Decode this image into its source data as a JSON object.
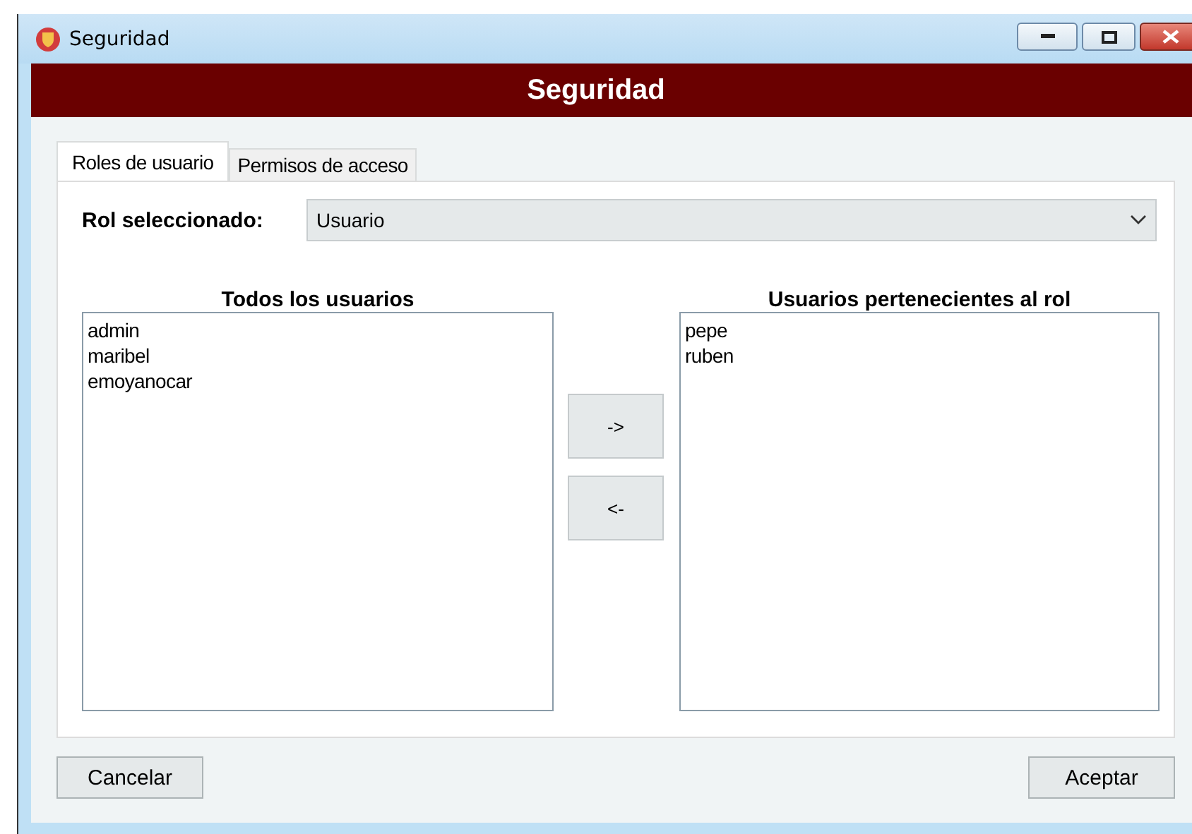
{
  "window": {
    "title": "Seguridad"
  },
  "header": "Seguridad",
  "tabs": [
    {
      "label": "Roles de usuario",
      "selected": true
    },
    {
      "label": "Permisos de acceso",
      "selected": false
    }
  ],
  "role": {
    "label": "Rol seleccionado:",
    "value": "Usuario"
  },
  "all_users": {
    "title": "Todos los usuarios",
    "items": [
      "admin",
      "maribel",
      "emoyanocar"
    ]
  },
  "role_users": {
    "title": "Usuarios pertenecientes al rol",
    "items": [
      "pepe",
      "ruben"
    ]
  },
  "transfer_buttons": [
    "->",
    "<-"
  ],
  "buttons": {
    "cancel": "Cancelar",
    "accept": "Aceptar"
  }
}
